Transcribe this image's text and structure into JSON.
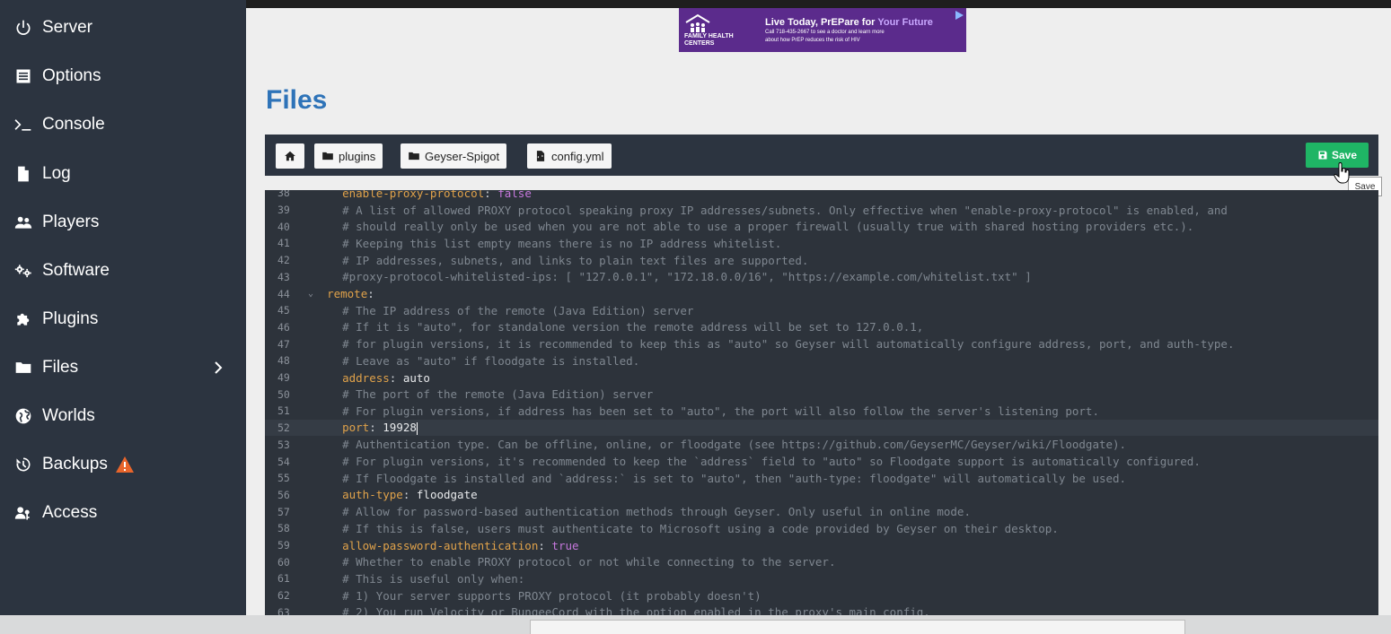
{
  "sidebar": {
    "items": [
      {
        "label": "Server",
        "icon": "power-icon"
      },
      {
        "label": "Options",
        "icon": "options-icon"
      },
      {
        "label": "Console",
        "icon": "terminal-icon"
      },
      {
        "label": "Log",
        "icon": "file-icon"
      },
      {
        "label": "Players",
        "icon": "users-icon"
      },
      {
        "label": "Software",
        "icon": "gears-icon"
      },
      {
        "label": "Plugins",
        "icon": "puzzle-icon"
      },
      {
        "label": "Files",
        "icon": "folder-icon"
      },
      {
        "label": "Worlds",
        "icon": "globe-icon"
      },
      {
        "label": "Backups",
        "icon": "history-icon"
      },
      {
        "label": "Access",
        "icon": "user-key-icon"
      }
    ]
  },
  "ad": {
    "org": "FAMILY HEALTH CENTERS",
    "headline_a": "Live Today, PrEPare for ",
    "headline_b": "Your Future",
    "sub1": "Call 718-435-2667 to see a doctor and learn more",
    "sub2": "about how PrEP reduces the risk of HIV"
  },
  "page": {
    "title": "Files"
  },
  "breadcrumbs": {
    "home_icon": "home-icon",
    "items": [
      "plugins",
      "Geyser-Spigot",
      "config.yml"
    ]
  },
  "toolbar": {
    "save_label": "Save",
    "tooltip": "Save"
  },
  "colors": {
    "sidebar": "#2c3440",
    "title": "#2e73b8",
    "save": "#1fb565",
    "editor": "#2d333b"
  },
  "editor": {
    "lines": [
      {
        "n": "38",
        "parts": [
          [
            "key",
            "    enable-proxy-protocol"
          ],
          [
            "code",
            ": "
          ],
          [
            "bool",
            "false"
          ]
        ]
      },
      {
        "n": "39",
        "parts": [
          [
            "cm",
            "    # A list of allowed PROXY protocol speaking proxy IP addresses/subnets. Only effective when \"enable-proxy-protocol\" is enabled, and"
          ]
        ]
      },
      {
        "n": "40",
        "parts": [
          [
            "cm",
            "    # should really only be used when you are not able to use a proper firewall (usually true with shared hosting providers etc.)."
          ]
        ]
      },
      {
        "n": "41",
        "parts": [
          [
            "cm",
            "    # Keeping this list empty means there is no IP address whitelist."
          ]
        ]
      },
      {
        "n": "42",
        "parts": [
          [
            "cm",
            "    # IP addresses, subnets, and links to plain text files are supported."
          ]
        ]
      },
      {
        "n": "43",
        "parts": [
          [
            "cm",
            "    #proxy-protocol-whitelisted-ips: [ \"127.0.0.1\", \"172.18.0.0/16\", \"https://example.com/whitelist.txt\" ]"
          ]
        ]
      },
      {
        "n": "44",
        "fold": true,
        "parts": [
          [
            "key",
            "  remote"
          ],
          [
            "code",
            ":"
          ]
        ]
      },
      {
        "n": "45",
        "parts": [
          [
            "cm",
            "    # The IP address of the remote (Java Edition) server"
          ]
        ]
      },
      {
        "n": "46",
        "parts": [
          [
            "cm",
            "    # If it is \"auto\", for standalone version the remote address will be set to 127.0.0.1,"
          ]
        ]
      },
      {
        "n": "47",
        "parts": [
          [
            "cm",
            "    # for plugin versions, it is recommended to keep this as \"auto\" so Geyser will automatically configure address, port, and auth-type."
          ]
        ]
      },
      {
        "n": "48",
        "parts": [
          [
            "cm",
            "    # Leave as \"auto\" if floodgate is installed."
          ]
        ]
      },
      {
        "n": "49",
        "parts": [
          [
            "key",
            "    address"
          ],
          [
            "code",
            ": "
          ],
          [
            "val",
            "auto"
          ]
        ]
      },
      {
        "n": "50",
        "parts": [
          [
            "cm",
            "    # The port of the remote (Java Edition) server"
          ]
        ]
      },
      {
        "n": "51",
        "parts": [
          [
            "cm",
            "    # For plugin versions, if address has been set to \"auto\", the port will also follow the server's listening port."
          ]
        ]
      },
      {
        "n": "52",
        "active": true,
        "parts": [
          [
            "key",
            "    port"
          ],
          [
            "code",
            ": "
          ],
          [
            "val",
            "19928"
          ]
        ]
      },
      {
        "n": "53",
        "parts": [
          [
            "cm",
            "    # Authentication type. Can be offline, online, or floodgate (see https://github.com/GeyserMC/Geyser/wiki/Floodgate)."
          ]
        ]
      },
      {
        "n": "54",
        "parts": [
          [
            "cm",
            "    # For plugin versions, it's recommended to keep the `address` field to \"auto\" so Floodgate support is automatically configured."
          ]
        ]
      },
      {
        "n": "55",
        "parts": [
          [
            "cm",
            "    # If Floodgate is installed and `address:` is set to \"auto\", then \"auth-type: floodgate\" will automatically be used."
          ]
        ]
      },
      {
        "n": "56",
        "parts": [
          [
            "key",
            "    auth-type"
          ],
          [
            "code",
            ": "
          ],
          [
            "val",
            "floodgate"
          ]
        ]
      },
      {
        "n": "57",
        "parts": [
          [
            "cm",
            "    # Allow for password-based authentication methods through Geyser. Only useful in online mode."
          ]
        ]
      },
      {
        "n": "58",
        "parts": [
          [
            "cm",
            "    # If this is false, users must authenticate to Microsoft using a code provided by Geyser on their desktop."
          ]
        ]
      },
      {
        "n": "59",
        "parts": [
          [
            "key",
            "    allow-password-authentication"
          ],
          [
            "code",
            ": "
          ],
          [
            "bool",
            "true"
          ]
        ]
      },
      {
        "n": "60",
        "parts": [
          [
            "cm",
            "    # Whether to enable PROXY protocol or not while connecting to the server."
          ]
        ]
      },
      {
        "n": "61",
        "parts": [
          [
            "cm",
            "    # This is useful only when:"
          ]
        ]
      },
      {
        "n": "62",
        "parts": [
          [
            "cm",
            "    # 1) Your server supports PROXY protocol (it probably doesn't)"
          ]
        ]
      },
      {
        "n": "63",
        "parts": [
          [
            "cm",
            "    # 2) You run Velocity or BungeeCord with the option enabled in the proxy's main config."
          ]
        ]
      }
    ]
  }
}
